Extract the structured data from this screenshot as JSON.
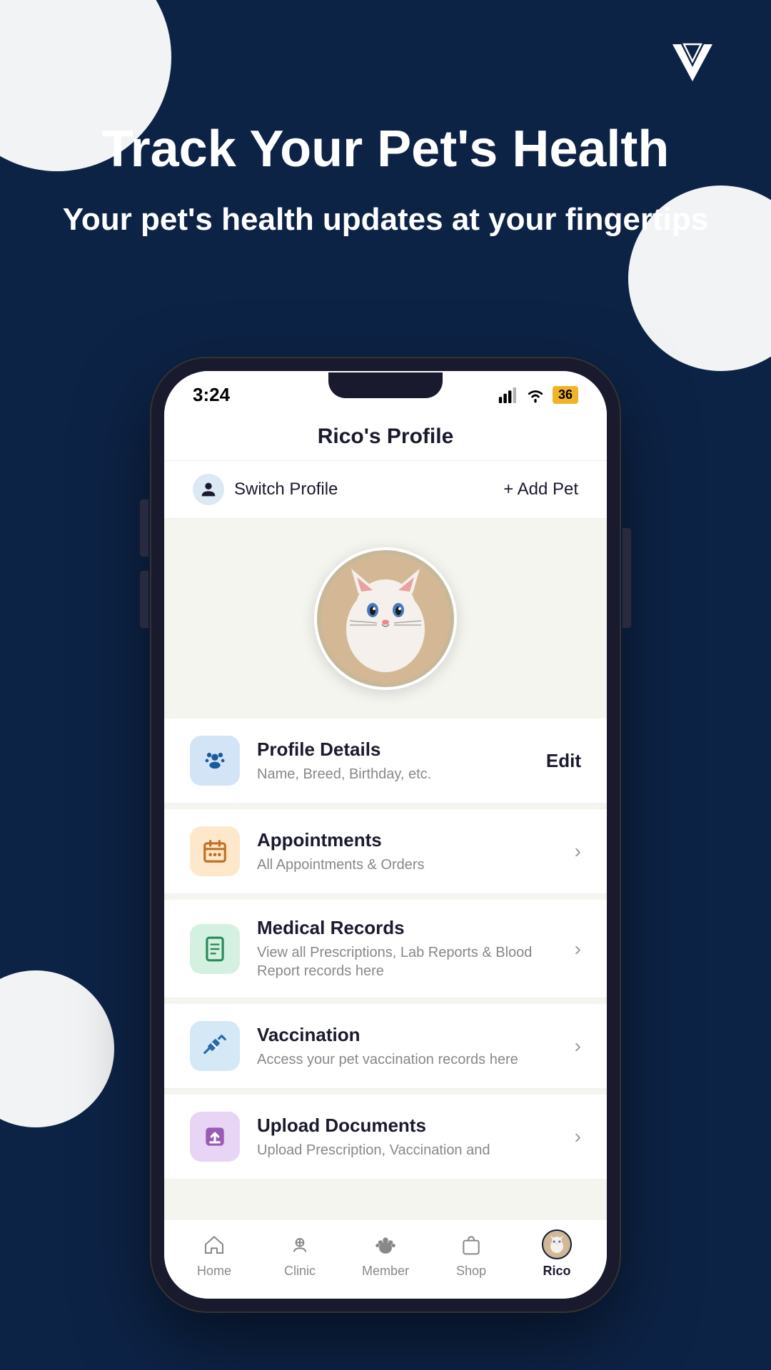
{
  "background": {
    "color": "#0d2346"
  },
  "hero": {
    "title": "Track Your Pet's Health",
    "subtitle": "Your pet's health updates at your fingertips"
  },
  "app": {
    "logo_letter": "V"
  },
  "phone": {
    "status_bar": {
      "time": "3:24",
      "battery": "36"
    },
    "page_title": "Rico's Profile",
    "switch_profile_label": "Switch Profile",
    "add_pet_label": "+ Add Pet",
    "pet_emoji": "🐱",
    "menu_items": [
      {
        "id": "profile-details",
        "title": "Profile Details",
        "subtitle": "Name, Breed, Birthday, etc.",
        "icon_emoji": "🐾",
        "icon_class": "icon-blue",
        "action": "Edit",
        "has_arrow": false
      },
      {
        "id": "appointments",
        "title": "Appointments",
        "subtitle": "All Appointments & Orders",
        "icon_emoji": "📋",
        "icon_class": "icon-orange",
        "action": "arrow",
        "has_arrow": true
      },
      {
        "id": "medical-records",
        "title": "Medical Records",
        "subtitle": "View all Prescriptions, Lab Reports & Blood Report records here",
        "icon_emoji": "📄",
        "icon_class": "icon-green",
        "action": "arrow",
        "has_arrow": true
      },
      {
        "id": "vaccination",
        "title": "Vaccination",
        "subtitle": "Access your pet vaccination records here",
        "icon_emoji": "💉",
        "icon_class": "icon-light-blue",
        "action": "arrow",
        "has_arrow": true
      },
      {
        "id": "upload-documents",
        "title": "Upload Documents",
        "subtitle": "Upload Prescription, Vaccination and",
        "icon_emoji": "⬆️",
        "icon_class": "icon-purple",
        "action": "arrow",
        "has_arrow": true
      }
    ],
    "bottom_nav": [
      {
        "id": "home",
        "label": "Home",
        "icon": "🏠",
        "active": false
      },
      {
        "id": "clinic",
        "label": "Clinic",
        "icon": "🏥",
        "active": false
      },
      {
        "id": "member",
        "label": "Member",
        "icon": "🐾",
        "active": false
      },
      {
        "id": "shop",
        "label": "Shop",
        "icon": "🛍️",
        "active": false
      },
      {
        "id": "rico",
        "label": "Rico",
        "icon": "🐱",
        "active": true
      }
    ]
  }
}
